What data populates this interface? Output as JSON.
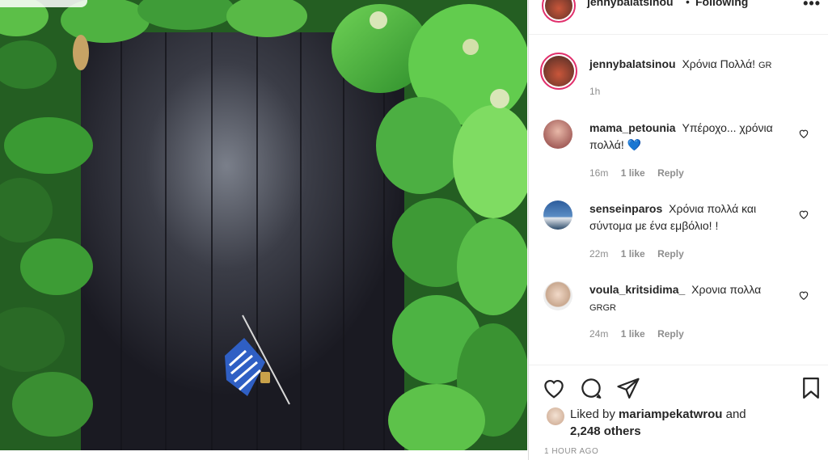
{
  "post": {
    "author": "jennybalatsinou",
    "separator": "•",
    "follow_status": "Following",
    "more_label": "•••",
    "caption": "Χρόνια Πολλά!",
    "caption_tag": "GR",
    "caption_time": "1h"
  },
  "comments": [
    {
      "username": "mama_petounia",
      "text": "Υπέροχο... χρόνια πολλά!",
      "emoji": "💙",
      "tag": "",
      "time": "16m",
      "likes": "1 like",
      "reply": "Reply"
    },
    {
      "username": "senseinparos",
      "text": "Χρόνια πολλά και σύντομα με ένα εμβόλιο! !",
      "emoji": "",
      "tag": "",
      "time": "22m",
      "likes": "1 like",
      "reply": "Reply"
    },
    {
      "username": "voula_kritsidima_",
      "text": "Χρονια πολλα",
      "emoji": "",
      "tag": "GRGR",
      "time": "24m",
      "likes": "1 like",
      "reply": "Reply"
    }
  ],
  "likes": {
    "prefix": "Liked by",
    "user": "mariampekatwrou",
    "conjunction": "and",
    "others": "2,248 others"
  },
  "timestamp": "1 HOUR AGO",
  "colors": {
    "story_ring": "#e1306c",
    "heart_blue": "#1d6fd6",
    "muted": "#8e8e8e",
    "text": "#262626"
  },
  "icons": [
    "heart-icon",
    "comment-icon",
    "share-icon",
    "bookmark-icon",
    "heart-small-icon",
    "more-icon"
  ]
}
